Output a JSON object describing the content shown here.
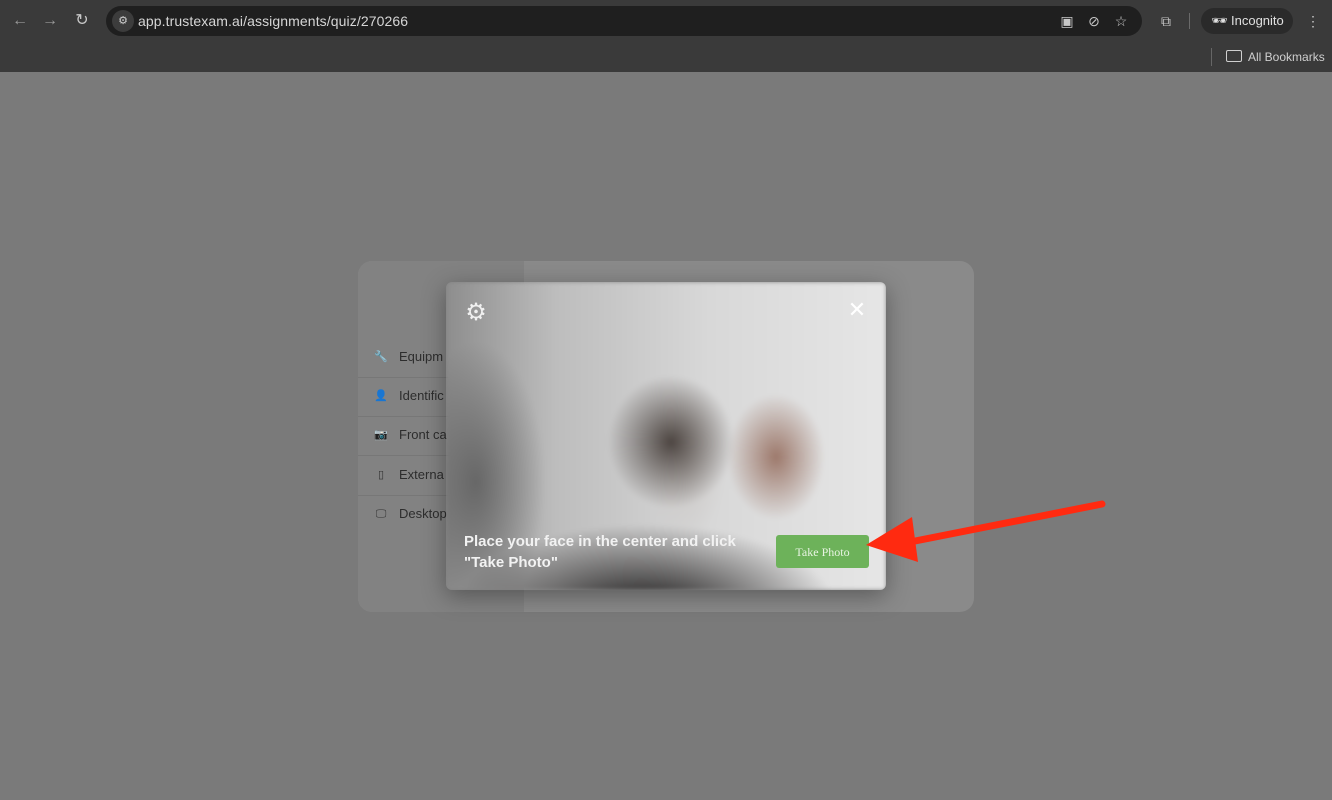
{
  "browser": {
    "url": "app.trustexam.ai/assignments/quiz/270266",
    "incognito_label": "Incognito",
    "bookmarks_label": "All Bookmarks"
  },
  "background": {
    "steps": [
      {
        "icon": "wrench-icon",
        "glyph": "🔧",
        "label": "Equipm"
      },
      {
        "icon": "person-icon",
        "glyph": "👤",
        "label": "Identific"
      },
      {
        "icon": "camera-icon",
        "glyph": "📷",
        "label": "Front ca"
      },
      {
        "icon": "phone-icon",
        "glyph": "▯",
        "label": "Externa"
      },
      {
        "icon": "monitor-icon",
        "glyph": "🖵",
        "label": "Desktop"
      }
    ]
  },
  "modal": {
    "instruction": "Place your face in the center and click \"Take Photo\"",
    "take_photo_label": "Take Photo"
  },
  "colors": {
    "take_photo_button": "#6db25a",
    "annotation_arrow": "#ff2a10"
  }
}
